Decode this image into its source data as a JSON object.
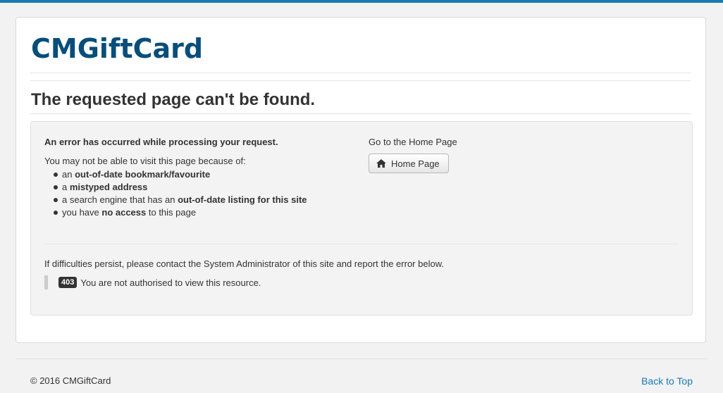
{
  "header": {
    "brand": "CMGiftCard"
  },
  "main": {
    "title": "The requested page can't be found.",
    "error_heading": "An error has occurred while processing your request.",
    "reasons_intro": "You may not be able to visit this page because of:",
    "reasons": [
      {
        "pre": "an ",
        "bold": "out-of-date bookmark/favourite",
        "post": ""
      },
      {
        "pre": "a ",
        "bold": "mistyped address",
        "post": ""
      },
      {
        "pre": "a search engine that has an ",
        "bold": "out-of-date listing for this site",
        "post": ""
      },
      {
        "pre": "you have ",
        "bold": "no access",
        "post": " to this page"
      }
    ],
    "home": {
      "label": "Go to the Home Page",
      "button_label": "Home Page",
      "icon": "home-icon"
    },
    "persist_text": "If difficulties persist, please contact the System Administrator of this site and report the error below.",
    "error": {
      "code": "403",
      "message": "You are not authorised to view this resource."
    }
  },
  "footer": {
    "copyright": "© 2016 CMGiftCard",
    "back_to_top": "Back to Top"
  },
  "colors": {
    "brand": "#074e7a",
    "accent": "#1a7ab0",
    "badge": "#333333"
  }
}
